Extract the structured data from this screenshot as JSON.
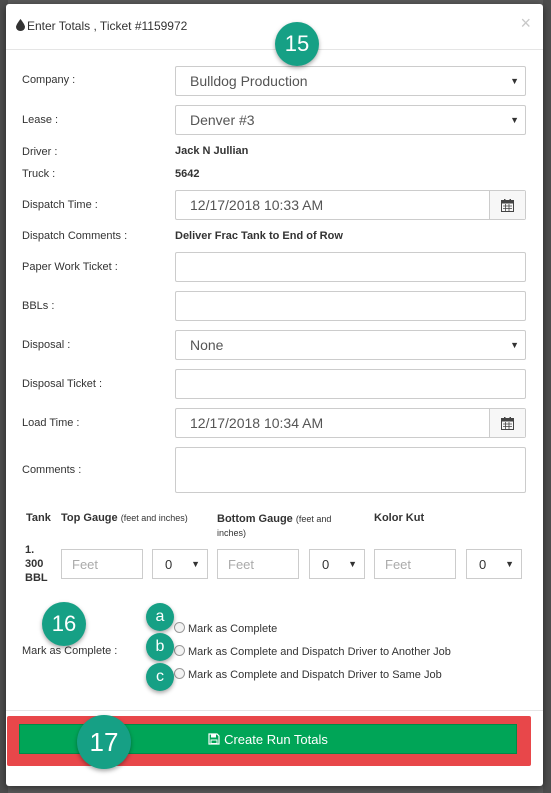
{
  "modal": {
    "title": "Enter Totals , Ticket #1159972",
    "close": "×"
  },
  "form": {
    "company_label": "Company :",
    "company_value": "Bulldog Production",
    "lease_label": "Lease :",
    "lease_value": "Denver #3",
    "driver_label": "Driver :",
    "driver_value": "Jack N Jullian",
    "truck_label": "Truck :",
    "truck_value": "5642",
    "dispatch_time_label": "Dispatch Time :",
    "dispatch_time_value": "12/17/2018 10:33 AM",
    "dispatch_comments_label": "Dispatch Comments :",
    "dispatch_comments_value": "Deliver Frac Tank to End of Row",
    "paper_ticket_label": "Paper Work Ticket :",
    "paper_ticket_value": "",
    "bbls_label": "BBLs :",
    "bbls_value": "",
    "disposal_label": "Disposal :",
    "disposal_value": "None",
    "disposal_ticket_label": "Disposal Ticket :",
    "disposal_ticket_value": "",
    "load_time_label": "Load Time :",
    "load_time_value": "12/17/2018 10:34 AM",
    "comments_label": "Comments :",
    "comments_value": ""
  },
  "gauges": {
    "tank_header": "Tank",
    "top_header": "Top Gauge",
    "top_sub": "(feet and inches)",
    "bottom_header": "Bottom Gauge",
    "bottom_sub": "(feet and inches)",
    "kolor_header": "Kolor Kut",
    "tank_row_label": [
      "1.",
      "300",
      "BBL"
    ],
    "feet_placeholder": "Feet",
    "top_inches": "0",
    "bottom_inches": "0",
    "kolor_inches": "0"
  },
  "complete": {
    "label": "Mark as Complete :",
    "options": [
      "Mark as Complete",
      "Mark as Complete and Dispatch Driver to Another Job",
      "Mark as Complete and Dispatch Driver to Same Job"
    ]
  },
  "footer": {
    "create_button": "Create Run Totals"
  },
  "annotations": {
    "b15": "15",
    "b16": "16",
    "b17": "17",
    "ba": "a",
    "bb": "b",
    "bc": "c"
  },
  "colors": {
    "accent_badge": "#16a085",
    "create_button": "#00a557",
    "highlight": "#e8474a"
  }
}
